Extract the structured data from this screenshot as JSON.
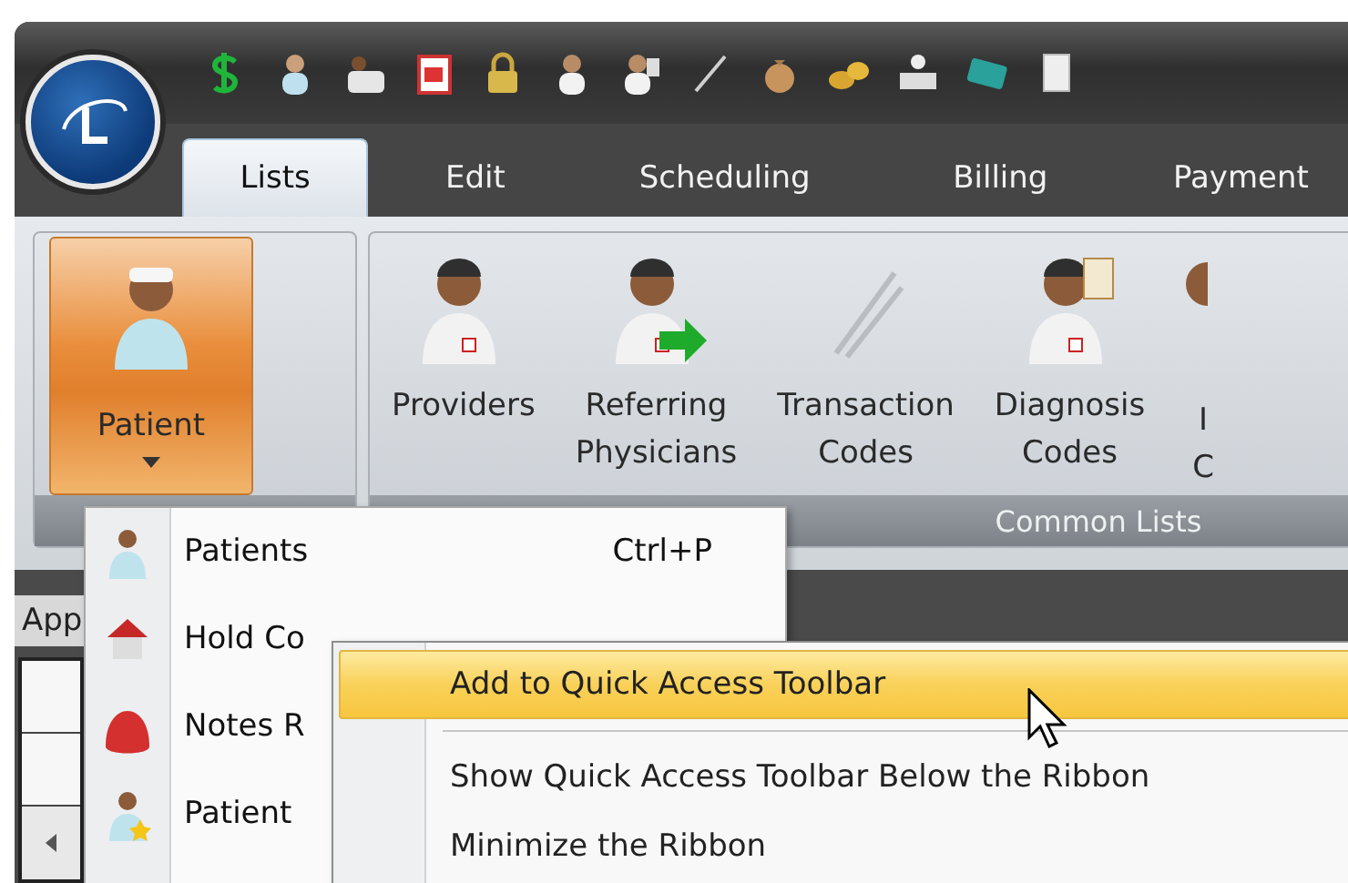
{
  "tabs": [
    {
      "label": "Lists",
      "selected": true
    },
    {
      "label": "Edit",
      "selected": false
    },
    {
      "label": "Scheduling",
      "selected": false
    },
    {
      "label": "Billing",
      "selected": false
    },
    {
      "label": "Payment",
      "selected": false
    }
  ],
  "ribbon": {
    "groups": [
      {
        "buttons": [
          {
            "lines": [
              "Patient"
            ],
            "pressed": true,
            "dropdown": true
          }
        ]
      },
      {
        "label": "Common Lists",
        "buttons": [
          {
            "lines": [
              "Providers"
            ],
            "pressed": false,
            "dropdown": false
          },
          {
            "lines": [
              "Referring",
              "Physicians"
            ],
            "pressed": false,
            "dropdown": false
          },
          {
            "lines": [
              "Transaction",
              "Codes"
            ],
            "pressed": false,
            "dropdown": false
          },
          {
            "lines": [
              "Diagnosis",
              "Codes"
            ],
            "pressed": false,
            "dropdown": false
          },
          {
            "lines": [
              "I",
              "C"
            ],
            "pressed": false,
            "dropdown": false
          }
        ]
      }
    ]
  },
  "workspace": {
    "label": "App"
  },
  "dropdown_menu": {
    "items": [
      {
        "label": "Patients",
        "shortcut": "Ctrl+P"
      },
      {
        "label": "Hold Co"
      },
      {
        "label": "Notes R"
      },
      {
        "label": "Patient"
      }
    ]
  },
  "context_menu": {
    "items": [
      {
        "label": "Add to Quick Access Toolbar",
        "highlighted": true,
        "separator_after": true
      },
      {
        "label": "Show Quick Access Toolbar Below the Ribbon",
        "highlighted": false,
        "separator_after": false
      },
      {
        "label": "Minimize the Ribbon",
        "highlighted": false,
        "separator_after": false
      }
    ]
  }
}
